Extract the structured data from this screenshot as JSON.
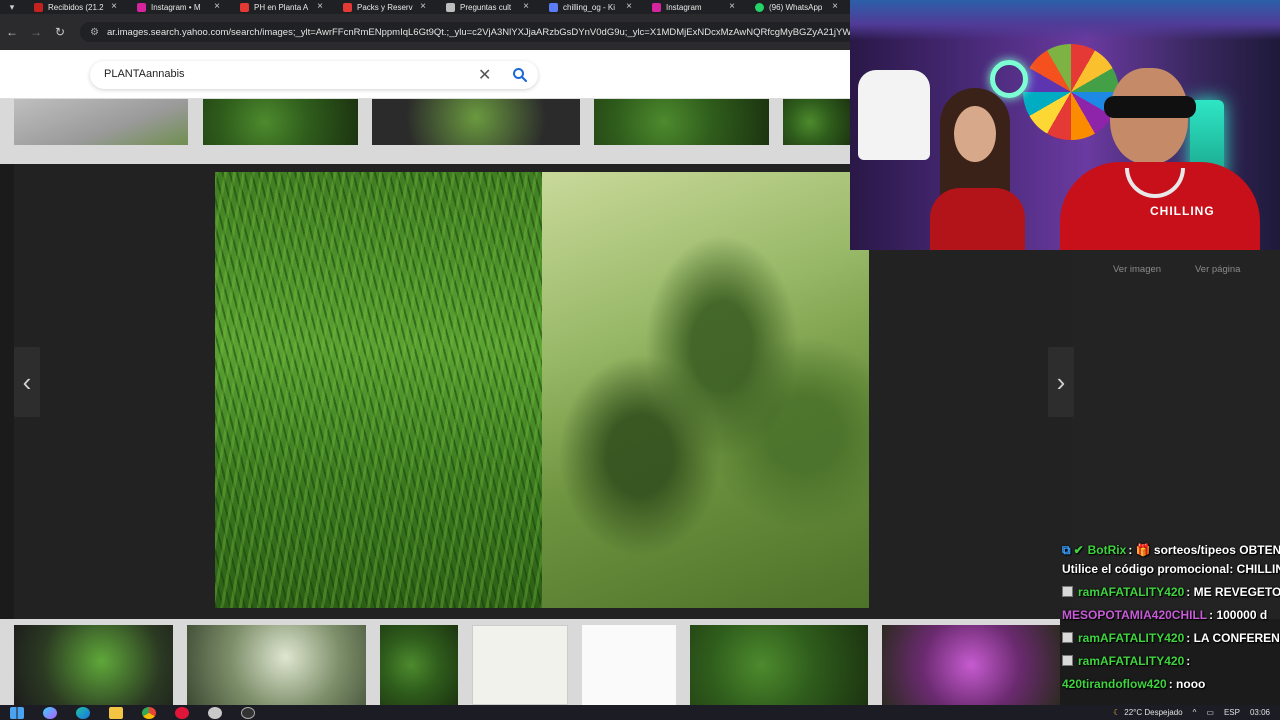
{
  "browser": {
    "tabs": [
      {
        "label": "Recibidos (21.2",
        "color": "#c5221f"
      },
      {
        "label": "Instagram • M",
        "color": "#d6249f"
      },
      {
        "label": "PH en Planta A",
        "color": "#e53935"
      },
      {
        "label": "Packs y Reserv",
        "color": "#e53935"
      },
      {
        "label": "Preguntas cult",
        "color": "#bdbdbd"
      },
      {
        "label": "chilling_og - Ki",
        "color": "#5b7cf7"
      },
      {
        "label": "Instagram",
        "color": "#d6249f"
      },
      {
        "label": "(96) WhatsApp",
        "color": "#25d366"
      }
    ],
    "url": "ar.images.search.yahoo.com/search/images;_ylt=AwrFFcnRmENppmIqL6Gt9Qt.;_ylu=c2VjA3NlYXJjaARzbGsDYnV0dG9u;_ylc=X1MDMjExNDcxMzAwNQRfcgMyBGZyA21jYWZlZQ"
  },
  "search": {
    "query": "PLANTAannabis"
  },
  "viewer": {
    "prev_label": "‹",
    "next_label": "›",
    "view_image_label": "Ver imagen",
    "view_page_label": "Ver página"
  },
  "stream": {
    "shirt_text": "CHILLING",
    "chat": [
      {
        "user": "BotRix",
        "user_color": "#3fd43f",
        "text": ": 🎁 sorteos/tipeos OBTEN"
      },
      {
        "user": "",
        "user_color": "#ffffff",
        "text": "Utilice el código promocional: CHILLIN"
      },
      {
        "user": "ramAFATALITY420",
        "user_color": "#3fd43f",
        "text": ": ME REVEGETO"
      },
      {
        "user": "MESOPOTAMIA420CHILL",
        "user_color": "#c85bd8",
        "text": ": 100000 d"
      },
      {
        "user": "ramAFATALITY420",
        "user_color": "#3fd43f",
        "text": ": LA CONFEREN"
      },
      {
        "user": "ramAFATALITY420",
        "user_color": "#3fd43f",
        "text": ":"
      },
      {
        "user": "420tirandoflow420",
        "user_color": "#3fd43f",
        "text": ": nooo"
      }
    ]
  },
  "taskbar": {
    "weather": "22°C  Despejado",
    "lang": "ESP",
    "time": "03:06"
  }
}
